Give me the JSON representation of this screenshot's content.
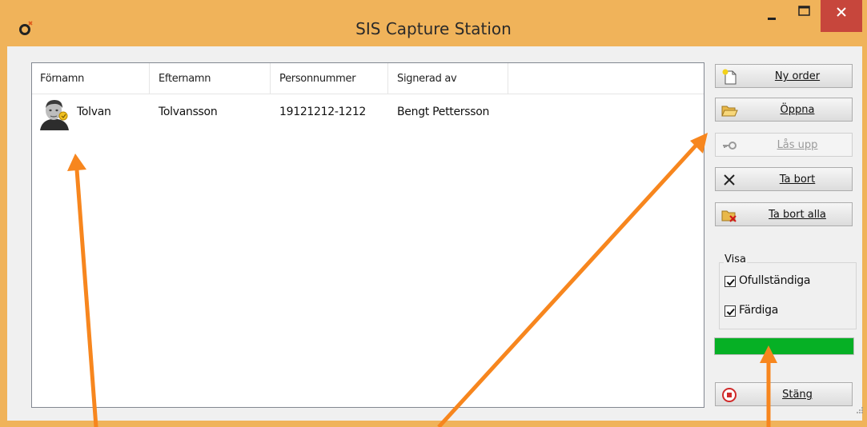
{
  "window": {
    "title": "SIS Capture Station",
    "title_color": "#f0b35a",
    "close_color": "#c7463c"
  },
  "list": {
    "columns": [
      "Förnamn",
      "Efternamn",
      "Personnummer",
      "Signerad av"
    ],
    "rows": [
      {
        "fornamn": "Tolvan",
        "efternamn": "Tolvansson",
        "personnummer": "19121212-1212",
        "signerad_av": "Bengt Pettersson",
        "icon": "person-avatar-icon"
      }
    ]
  },
  "buttons": {
    "ny_order": {
      "label": "Ny order",
      "icon": "new-document-icon",
      "enabled": true
    },
    "oppna": {
      "label": "Öppna",
      "icon": "open-folder-icon",
      "enabled": true
    },
    "las_upp": {
      "label": "Lås upp",
      "icon": "key-icon",
      "enabled": false
    },
    "ta_bort": {
      "label": "Ta bort",
      "icon": "x-icon",
      "enabled": true
    },
    "ta_bort_alla": {
      "label": "Ta bort alla",
      "icon": "folder-delete-icon",
      "enabled": true
    },
    "stang": {
      "label": "Stäng",
      "icon": "stop-icon",
      "enabled": true
    }
  },
  "visa": {
    "title": "Visa",
    "ofullstandiga": {
      "label": "Ofullständiga",
      "checked": true
    },
    "fardiga": {
      "label": "Färdiga",
      "checked": true
    }
  },
  "progress": {
    "value": 1.0,
    "color": "#06b025"
  },
  "annotation": {
    "arrow_color": "#f7861e"
  }
}
